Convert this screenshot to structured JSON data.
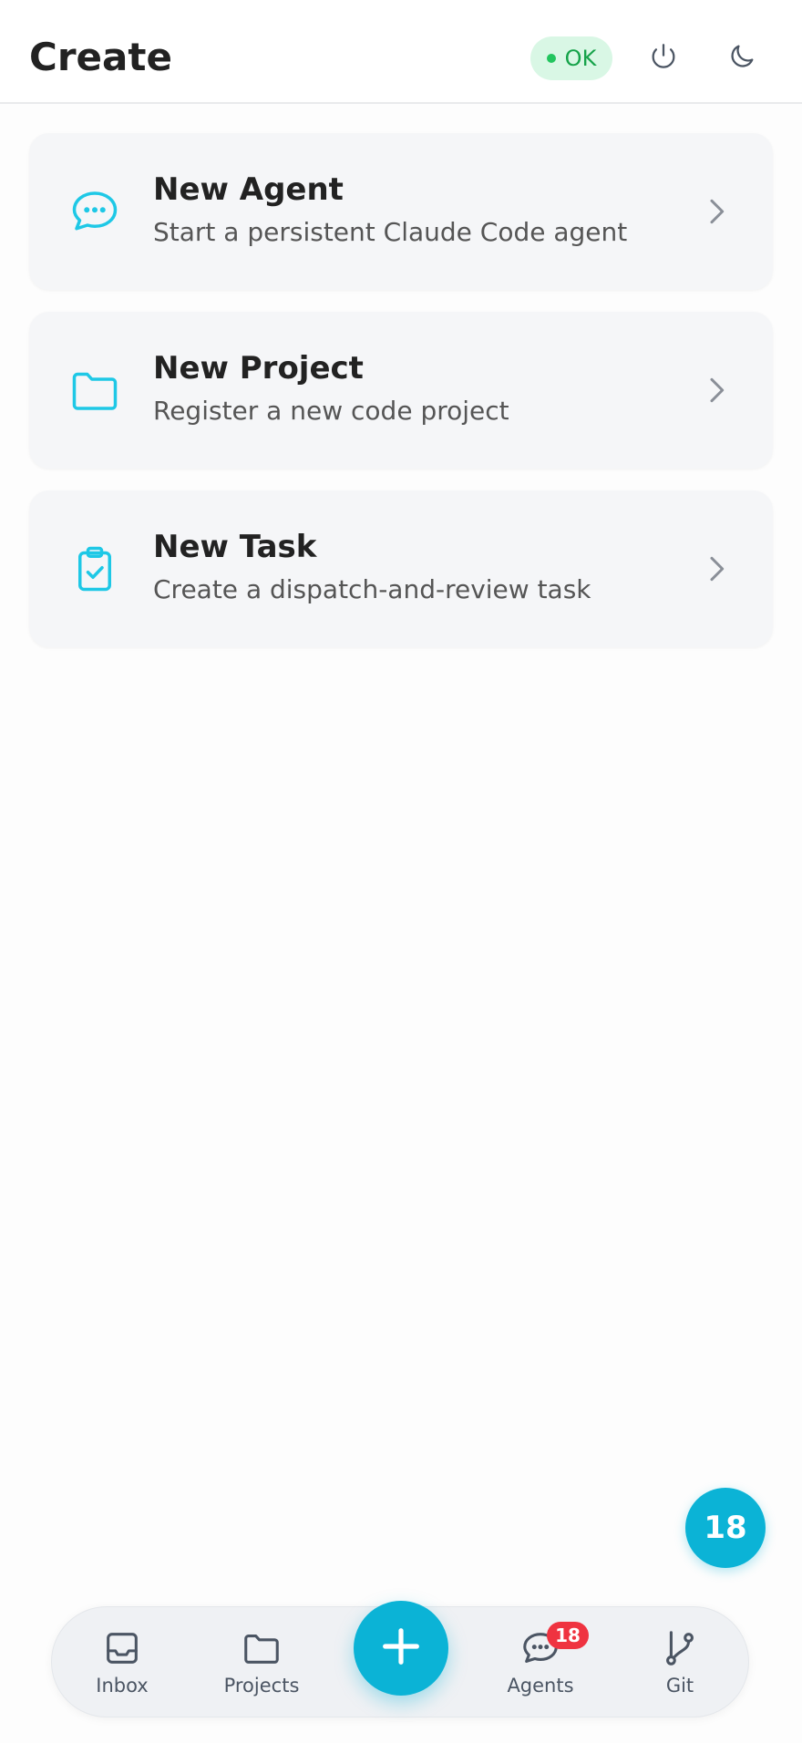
{
  "header": {
    "title": "Create",
    "status_label": "OK",
    "power_icon": "power-icon",
    "theme_icon": "moon-icon"
  },
  "cards": [
    {
      "title": "New Agent",
      "subtitle": "Start a persistent Claude Code agent",
      "icon": "chat-bubble-icon"
    },
    {
      "title": "New Project",
      "subtitle": "Register a new code project",
      "icon": "folder-icon"
    },
    {
      "title": "New Task",
      "subtitle": "Create a dispatch-and-review task",
      "icon": "clipboard-check-icon"
    }
  ],
  "floating_count": "18",
  "bottom_nav": {
    "items": [
      {
        "label": "Inbox",
        "icon": "inbox-icon"
      },
      {
        "label": "Projects",
        "icon": "folder-icon"
      },
      {
        "label": "Agents",
        "icon": "chat-bubble-icon",
        "badge": "18"
      },
      {
        "label": "Git",
        "icon": "git-branch-icon"
      }
    ],
    "fab_icon": "plus-icon"
  },
  "colors": {
    "accent": "#0bb3d6",
    "ok_bg": "#d9f7e5",
    "ok_text": "#16a34a",
    "badge_red": "#ef3340"
  }
}
